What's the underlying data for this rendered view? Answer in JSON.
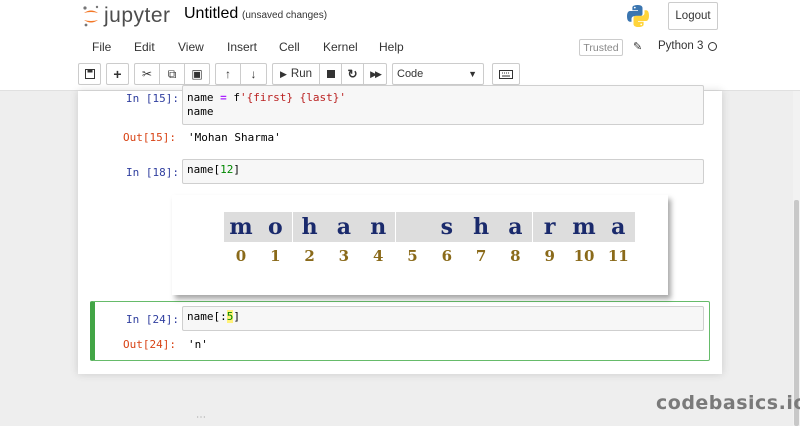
{
  "header": {
    "logo_text": "jupyter",
    "notebook_title": "Untitled",
    "save_status": "(unsaved changes)",
    "logout_label": "Logout"
  },
  "menu": {
    "items": [
      "File",
      "Edit",
      "View",
      "Insert",
      "Cell",
      "Kernel",
      "Help"
    ],
    "trusted_label": "Trusted",
    "kernel_name": "Python 3"
  },
  "toolbar": {
    "run_label": "Run",
    "cell_type": "Code",
    "icons": [
      "save-icon",
      "add-cell-icon",
      "cut-icon",
      "copy-icon",
      "paste-icon",
      "move-up-icon",
      "move-down-icon",
      "run-icon",
      "stop-icon",
      "restart-icon",
      "fast-forward-icon",
      "keyboard-icon"
    ]
  },
  "cells": [
    {
      "in_prompt": "In [15]:",
      "code_line1_pre": "name ",
      "code_line1_op": "=",
      "code_line1_mid": " f",
      "code_line1_str": "'{first} {last}'",
      "code_line2": "name",
      "out_prompt": "Out[15]:",
      "output": "'Mohan Sharma'"
    },
    {
      "in_prompt": "In [18]:",
      "code_pre": "name[",
      "code_num": "12",
      "code_post": "]"
    },
    {
      "in_prompt": "In [24]:",
      "code_pre": "name[:",
      "code_num": "5",
      "code_post": "]",
      "out_prompt": "Out[24]:",
      "output": "'n'"
    }
  ],
  "diagram": {
    "letters": [
      "m",
      "o",
      "h",
      "a",
      "n",
      "",
      "s",
      "h",
      "a",
      "r",
      "m",
      "a"
    ],
    "indices": [
      "0",
      "1",
      "2",
      "3",
      "4",
      "5",
      "6",
      "7",
      "8",
      "9",
      "10",
      "11"
    ]
  },
  "watermark": "codebasics.io",
  "colors": {
    "in_prompt": "#303f9f",
    "out_prompt": "#d84315",
    "selected_cell_border": "#42a546",
    "diagram_letter": "#1a2a6c",
    "diagram_index": "#8a6a1a"
  }
}
